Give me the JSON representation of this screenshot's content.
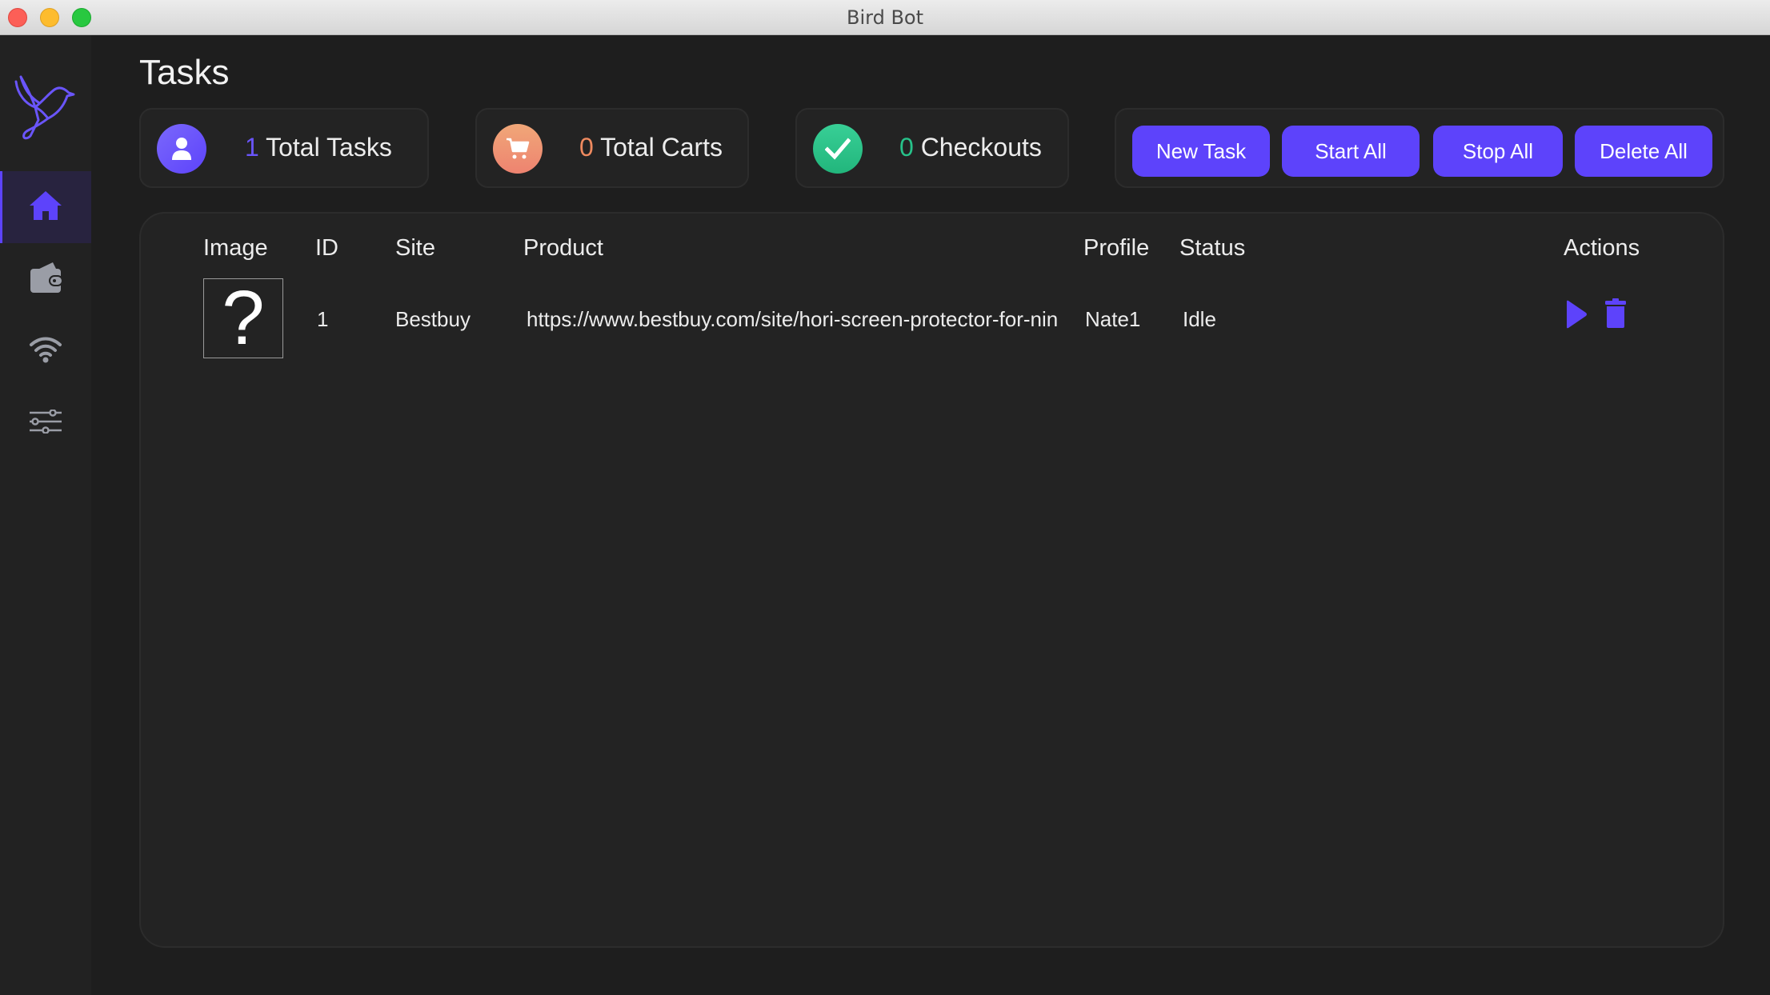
{
  "window": {
    "title": "Bird Bot"
  },
  "sidebar": {
    "items": [
      {
        "name": "home",
        "icon": "home-icon",
        "active": true
      },
      {
        "name": "profiles",
        "icon": "wallet-icon",
        "active": false
      },
      {
        "name": "proxies",
        "icon": "wifi-icon",
        "active": false
      },
      {
        "name": "settings",
        "icon": "sliders-icon",
        "active": false
      }
    ],
    "accent_color": "#5d43fb"
  },
  "header": {
    "title": "Tasks",
    "stats": [
      {
        "count": "1",
        "label": "Total Tasks",
        "icon": "user-icon",
        "color": "#6a55fb"
      },
      {
        "count": "0",
        "label": "Total Carts",
        "icon": "cart-icon",
        "color": "#ef8a5f"
      },
      {
        "count": "0",
        "label": "Checkouts",
        "icon": "check-icon",
        "color": "#27c28a"
      }
    ],
    "buttons": {
      "new_task": "New Task",
      "start_all": "Start All",
      "stop_all": "Stop All",
      "delete_all": "Delete All"
    }
  },
  "table": {
    "columns": [
      "Image",
      "ID",
      "Site",
      "Product",
      "Profile",
      "Status",
      "Actions"
    ],
    "rows": [
      {
        "image": "?",
        "id": "1",
        "site": "Bestbuy",
        "product": "https://www.bestbuy.com/site/hori-screen-protector-for-nin",
        "profile": "Nate1",
        "status": "Idle",
        "actions": [
          "play-icon",
          "trash-icon"
        ]
      }
    ]
  }
}
